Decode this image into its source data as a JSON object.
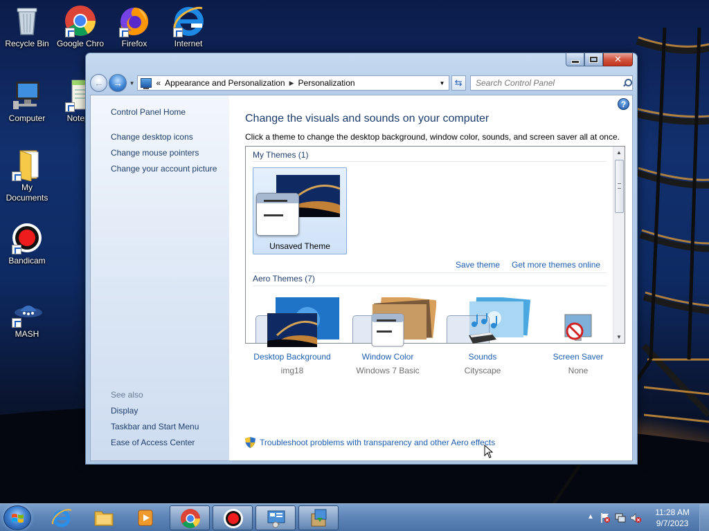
{
  "desktop": {
    "icons": [
      {
        "label": "Recycle Bin"
      },
      {
        "label": "Google Chro"
      },
      {
        "label": "Firefox"
      },
      {
        "label": "Internet"
      },
      {
        "label": "Computer"
      },
      {
        "label": "Notepa"
      },
      {
        "label": "My Documents"
      },
      {
        "label": "Bandicam"
      },
      {
        "label": "MASH"
      }
    ]
  },
  "window": {
    "address": {
      "crumbs": [
        "Appearance and Personalization",
        "Personalization"
      ],
      "overflow": "«",
      "separator": "▶"
    },
    "search": {
      "placeholder": "Search Control Panel"
    },
    "left_pane": {
      "home": "Control Panel Home",
      "links": [
        "Change desktop icons",
        "Change mouse pointers",
        "Change your account picture"
      ],
      "see_also_title": "See also",
      "see_also": [
        "Display",
        "Taskbar and Start Menu",
        "Ease of Access Center"
      ]
    },
    "main": {
      "title": "Change the visuals and sounds on your computer",
      "subtitle": "Click a theme to change the desktop background, window color, sounds, and screen saver all at once.",
      "my_themes_title": "My Themes (1)",
      "unsaved_theme_label": "Unsaved Theme",
      "save_theme": "Save theme",
      "get_more_themes": "Get more themes online",
      "aero_themes_title": "Aero Themes (7)",
      "settings": [
        {
          "label": "Desktop Background",
          "value": "img18"
        },
        {
          "label": "Window Color",
          "value": "Windows 7 Basic"
        },
        {
          "label": "Sounds",
          "value": "Cityscape"
        },
        {
          "label": "Screen Saver",
          "value": "None"
        }
      ],
      "troubleshoot": "Troubleshoot problems with transparency and other Aero effects",
      "help": "?"
    }
  },
  "taskbar": {
    "time": "11:28 AM",
    "date": "9/7/2023"
  },
  "colors": {
    "link": "#1c5eb0",
    "heading": "#1a3c6c",
    "taskbar": "#5e86b8"
  }
}
